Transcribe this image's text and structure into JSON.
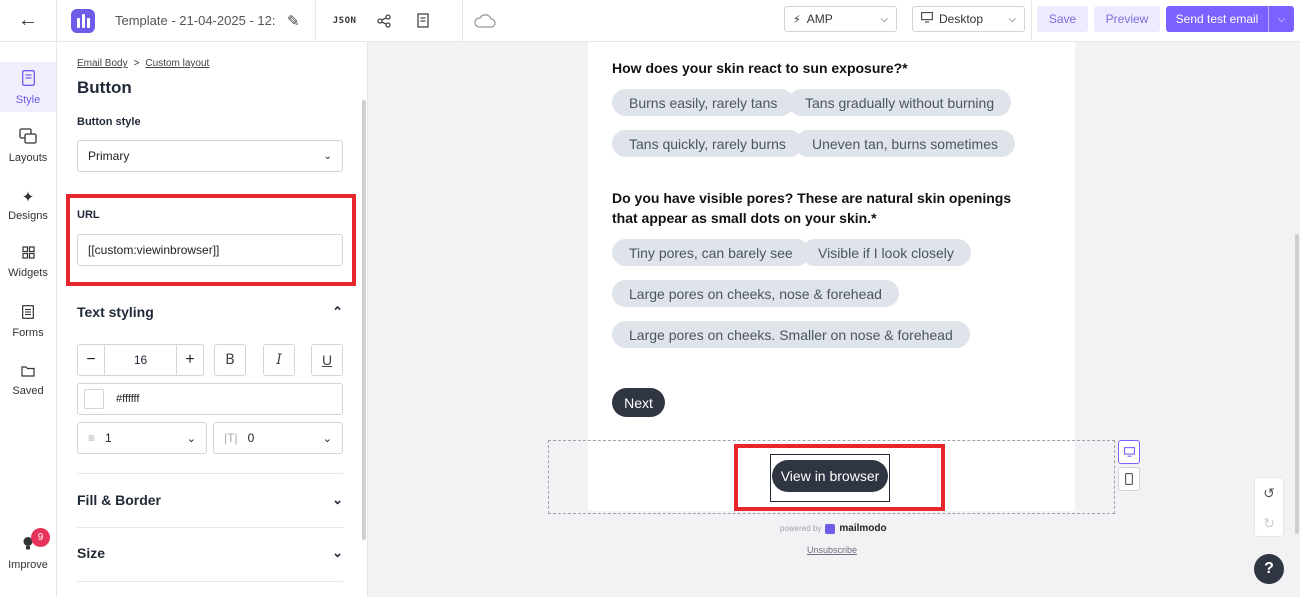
{
  "topbar": {
    "back_icon": "arrow-left-icon",
    "template_name": "Template - 21-04-2025 - 12:...",
    "json_label": "JSON",
    "amp_label": "AMP",
    "device_label": "Desktop",
    "save_label": "Save",
    "preview_label": "Preview",
    "send_label": "Send test email"
  },
  "rail": {
    "items": [
      {
        "label": "Style",
        "icon": "style-icon"
      },
      {
        "label": "Layouts",
        "icon": "layouts-icon"
      },
      {
        "label": "Designs",
        "icon": "designs-icon"
      },
      {
        "label": "Widgets",
        "icon": "widgets-icon"
      },
      {
        "label": "Forms",
        "icon": "forms-icon"
      },
      {
        "label": "Saved",
        "icon": "saved-icon"
      }
    ],
    "improve_label": "Improve",
    "improve_count": "9"
  },
  "panel": {
    "breadcrumb_root": "Email Body",
    "breadcrumb_current": "Custom layout",
    "title": "Button",
    "button_style_label": "Button style",
    "button_style_value": "Primary",
    "url_label": "URL",
    "url_value": "[[custom:viewinbrowser]]",
    "text_styling_label": "Text styling",
    "font_size": "16",
    "bold_label": "B",
    "italic_label": "I",
    "underline_label": "U",
    "text_color": "#ffffff",
    "line_height": "1",
    "letter_spacing": "0",
    "fill_border_label": "Fill & Border",
    "size_label": "Size"
  },
  "email": {
    "q1": "How does your skin react to sun exposure?*",
    "q1_options": [
      "Burns easily, rarely tans",
      "Tans gradually without burning",
      "Tans quickly, rarely burns",
      "Uneven tan, burns sometimes"
    ],
    "q2": "Do you have visible pores? These are natural skin openings that appear as small dots on your skin.*",
    "q2_options": [
      "Tiny pores, can barely see",
      "Visible if I look closely",
      "Large pores on cheeks, nose & forehead",
      "Large pores on cheeks. Smaller on nose & forehead"
    ],
    "next_label": "Next",
    "view_in_browser_label": "View in browser",
    "powered_by": "powered by",
    "brand": "mailmodo",
    "unsubscribe": "Unsubscribe"
  },
  "colors": {
    "accent": "#7b61ff",
    "highlight": "#e8262b",
    "dark_button": "#2f3542",
    "pill_bg": "#dfe3ea"
  }
}
